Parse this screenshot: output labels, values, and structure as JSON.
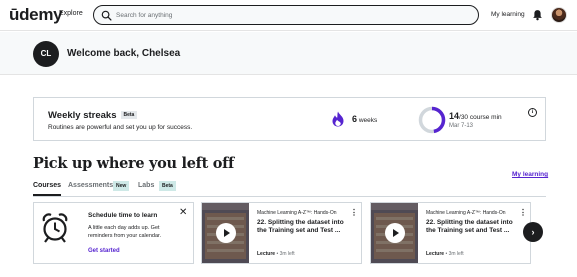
{
  "nav": {
    "logo_text": "ūdemy",
    "explore": "Explore",
    "search_placeholder": "Search for anything",
    "my_learning": "My learning",
    "icons": {
      "search": "search-icon",
      "bell": "bell-icon",
      "avatar": "user-avatar"
    }
  },
  "welcome": {
    "initials": "CL",
    "greeting": "Welcome back, Chelsea"
  },
  "streak": {
    "title": "Weekly streaks",
    "badge": "Beta",
    "subtitle": "Routines are powerful and set you up for success.",
    "weeks_value": "6",
    "weeks_label": "weeks",
    "minutes_done": "14",
    "minutes_goal": "/30 course min",
    "minutes_fraction": 0.47,
    "date_range": "Mar 7-13",
    "info_icon": "i",
    "accent_color": "#5624d0"
  },
  "pickup": {
    "heading": "Pick up where you left off",
    "my_learning_link": "My learning",
    "tabs": {
      "courses": "Courses",
      "assessments": "Assessments",
      "assessments_badge": "New",
      "labs": "Labs",
      "labs_badge": "Beta"
    }
  },
  "schedule": {
    "title": "Schedule time to learn",
    "body": "A little each day adds up. Get reminders from your calendar.",
    "cta": "Get started",
    "close": "✕"
  },
  "courses": [
    {
      "course_name": "Machine Learning A-Z™: Hands-On",
      "lecture_title": "22. Splitting the dataset into the Training set and Test ...",
      "lecture_label": "Lecture",
      "time_left": " • 3m left",
      "progress": 0.55
    },
    {
      "course_name": "Machine Learning A-Z™: Hands-On",
      "lecture_title": "22. Splitting the dataset into the Training set and Test ...",
      "lecture_label": "Lecture",
      "time_left": " • 3m left",
      "progress": 0.55
    }
  ],
  "next_arrow": "›"
}
